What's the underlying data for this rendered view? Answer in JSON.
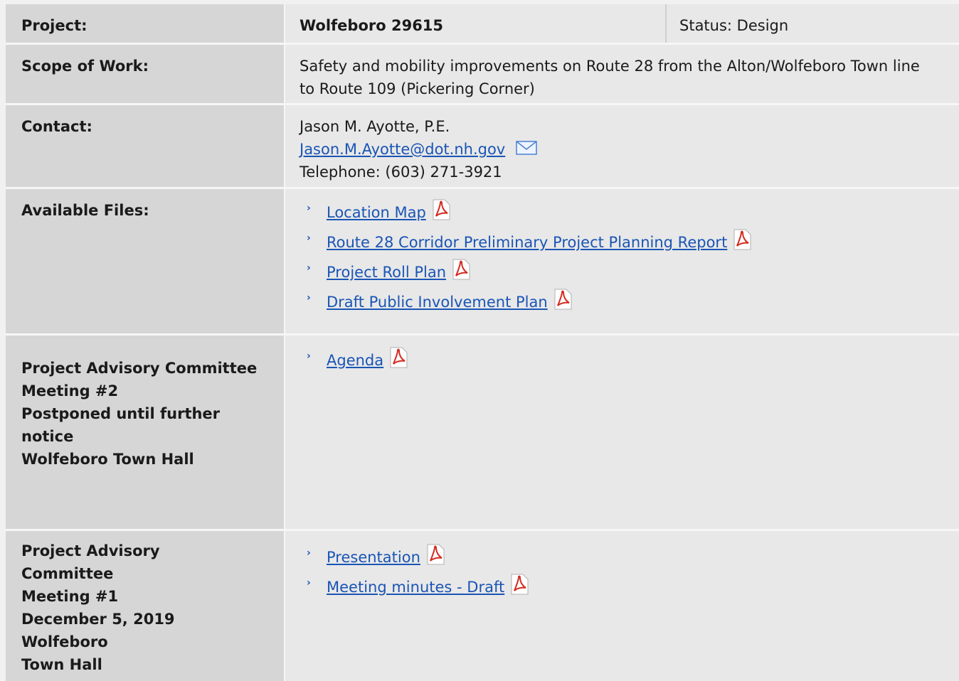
{
  "project": {
    "label": "Project:",
    "value": "Wolfeboro 29615",
    "status": "Status: Design"
  },
  "scope": {
    "label": "Scope of Work:",
    "line1": "Safety and mobility improvements on Route 28 from the Alton/Wolfeboro Town line",
    "line2": "to Route 109 (Pickering Corner)"
  },
  "contact": {
    "label": "Contact:",
    "name": "Jason M. Ayotte, P.E.",
    "email": "Jason.M.Ayotte@dot.nh.gov",
    "phone": "Telephone: (603) 271-3921",
    "email_icon": "envelope-icon"
  },
  "available_files": {
    "label": "Available Files:",
    "items": [
      {
        "label": "Location Map",
        "icon": "pdf-icon"
      },
      {
        "label": "Route 28 Corridor Preliminary Project Planning Report",
        "icon": "pdf-icon"
      },
      {
        "label": "Project Roll Plan",
        "icon": "pdf-icon"
      },
      {
        "label": "Draft Public Involvement Plan",
        "icon": "pdf-icon"
      }
    ]
  },
  "meeting2": {
    "label_lines": [
      "Project Advisory Committee",
      "Meeting #2",
      "Postponed until further",
      "notice",
      "Wolfeboro Town Hall"
    ],
    "items": [
      {
        "label": "Agenda",
        "icon": "pdf-icon"
      }
    ]
  },
  "meeting1": {
    "label_lines": [
      "Project Advisory",
      "Committee",
      "Meeting #1",
      "December 5, 2019",
      "Wolfeboro",
      "Town Hall"
    ],
    "items": [
      {
        "label": "Presentation",
        "icon": "pdf-icon"
      },
      {
        "label": "Meeting minutes - Draft",
        "icon": "pdf-icon"
      }
    ]
  },
  "colors": {
    "label_bg": "#d6d6d6",
    "value_bg": "#e8e8e8",
    "link": "#1a55b5",
    "pdf_red": "#d42a1f"
  }
}
